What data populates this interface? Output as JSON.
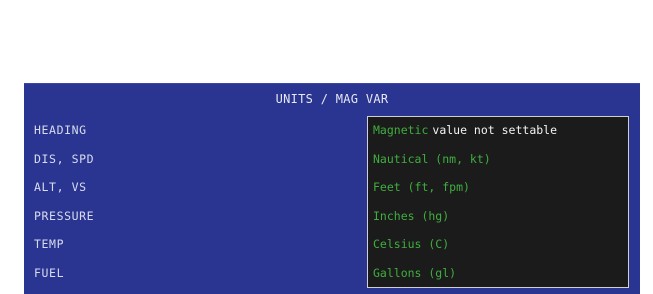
{
  "panel": {
    "title": "UNITS / MAG VAR"
  },
  "rows": [
    {
      "label": "HEADING",
      "value": "Magnetic",
      "note": "value not settable"
    },
    {
      "label": "DIS, SPD",
      "value": "Nautical (nm, kt)"
    },
    {
      "label": "ALT, VS",
      "value": "Feet (ft, fpm)"
    },
    {
      "label": "PRESSURE",
      "value": "Inches (hg)"
    },
    {
      "label": "TEMP",
      "value": "Celsius (C)"
    },
    {
      "label": "FUEL",
      "value": "Gallons (gl)"
    }
  ],
  "colors": {
    "panel_bg": "#2a3591",
    "value_box_bg": "#1b1b1b",
    "value_text": "#3fae3f",
    "label_text": "#d8dcef",
    "note_text": "#f2f2f2"
  }
}
